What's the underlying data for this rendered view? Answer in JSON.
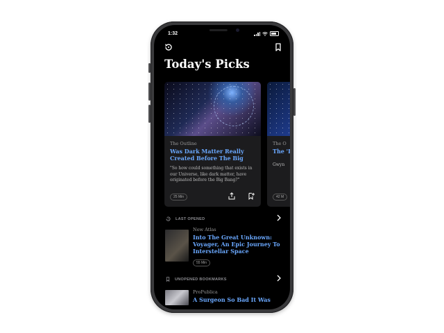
{
  "status": {
    "time": "1:32"
  },
  "header": {
    "title": "Today's Picks"
  },
  "cards": [
    {
      "source": "The Outline",
      "title": "Was Dark Matter Really Created Before The Big",
      "excerpt": "\"So how could something that exists in our Universe, like dark matter, have originated before the Big Bang?\"",
      "read_time": "25 Min"
    },
    {
      "source": "The O",
      "title": "The 'Livi",
      "excerpt": "Gwyn",
      "read_time": "42 M"
    }
  ],
  "last_opened": {
    "label": "LAST OPENED",
    "item": {
      "source": "New Atlas",
      "title": "Into The Great Unknown: Voyager, An Epic Journey To Interstellar Space",
      "read_time": "55 Min"
    }
  },
  "unopened_bookmarks": {
    "label": "UNOPENED BOOKMARKS",
    "item": {
      "source": "ProPublica",
      "title": "A Surgeon So Bad It Was"
    }
  },
  "colors": {
    "accent": "#6aa8ff",
    "background": "#000000",
    "card": "#1c1c1e"
  }
}
